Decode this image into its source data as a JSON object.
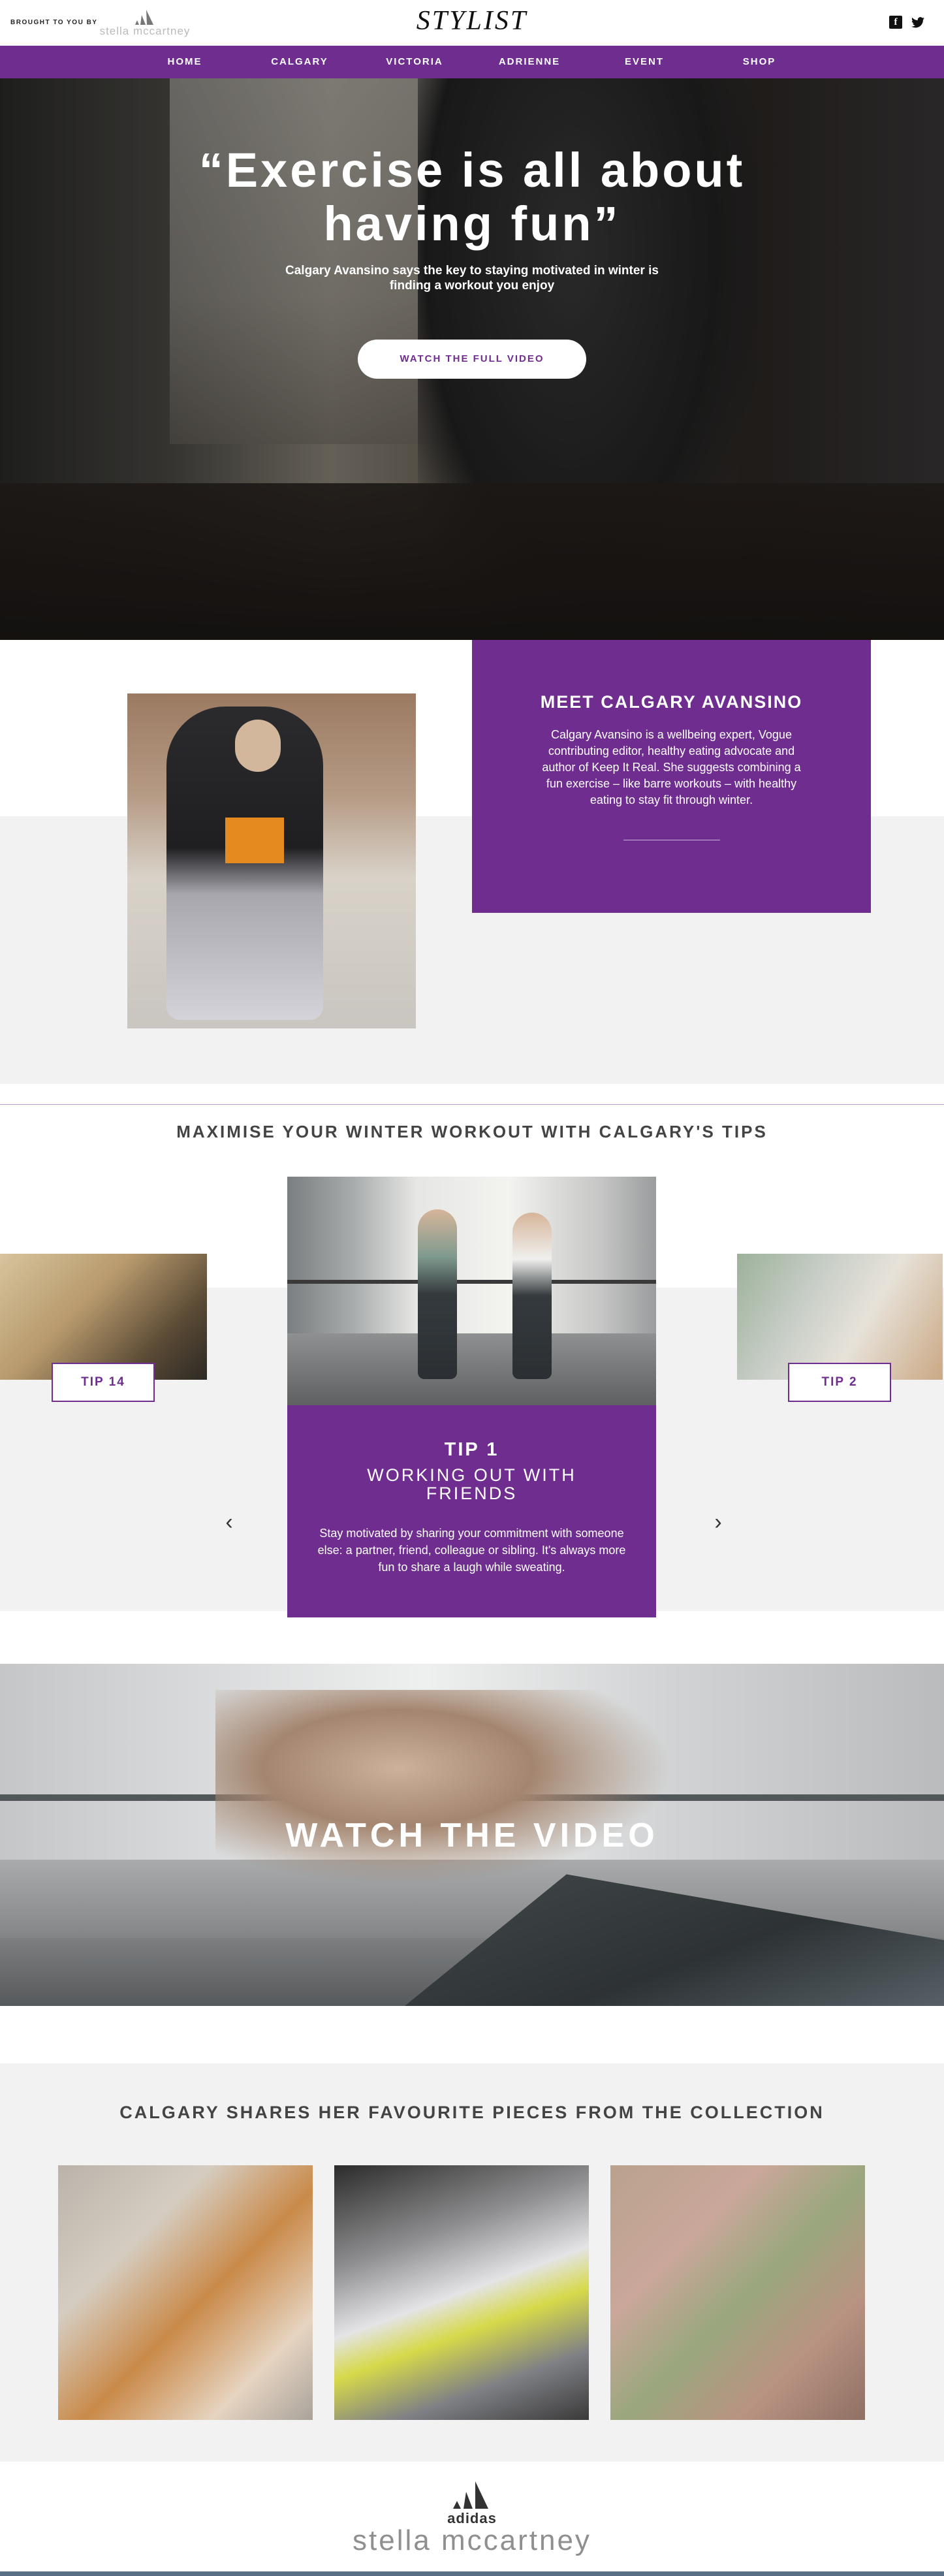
{
  "header": {
    "brought_to_you_by": "BROUGHT TO YOU BY",
    "sponsor_logo_text": "stella mccartney",
    "site_logo": "STYLIST",
    "social": [
      {
        "name": "facebook-icon",
        "glyph": "f"
      },
      {
        "name": "twitter-icon",
        "glyph": "🐦"
      }
    ]
  },
  "nav": {
    "items": [
      "HOME",
      "CALGARY",
      "VICTORIA",
      "ADRIENNE",
      "EVENT",
      "SHOP"
    ]
  },
  "hero": {
    "quote": "“Exercise is all about having fun”",
    "subtitle": "Calgary Avansino says the key to staying motivated in winter is finding a workout you enjoy",
    "button_label": "WATCH THE FULL VIDEO"
  },
  "meet": {
    "heading": "MEET CALGARY AVANSINO",
    "body": "Calgary Avansino is a wellbeing expert, Vogue contributing editor, healthy eating advocate and author of Keep It Real. She suggests combining a fun exercise – like barre workouts – with healthy eating to stay fit through winter."
  },
  "tips": {
    "heading": "MAXIMISE YOUR WINTER WORKOUT WITH CALGARY'S TIPS",
    "prev_tag": "TIP 14",
    "next_tag": "TIP 2",
    "current": {
      "number": "TIP 1",
      "title": "WORKING OUT WITH FRIENDS",
      "body": "Stay motivated by sharing your commitment with someone else: a partner, friend, colleague or sibling. It's always more fun to share a laugh while sweating."
    },
    "prev_arrow": "‹",
    "next_arrow": "›"
  },
  "video": {
    "title": "WATCH THE VIDEO"
  },
  "collection": {
    "heading": "CALGARY SHARES HER FAVOURITE PIECES FROM THE COLLECTION"
  },
  "footer": {
    "brand_top": "adidas",
    "brand_bottom": "stella mccartney"
  },
  "colors": {
    "accent": "#6f2e8f",
    "panel": "#f2f2f3",
    "text_dark": "#444444"
  }
}
